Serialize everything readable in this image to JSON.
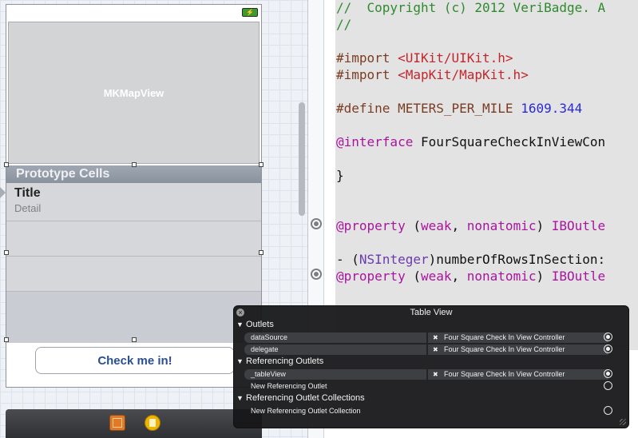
{
  "storyboard": {
    "map_view_label": "MKMapView",
    "section_header": "Prototype Cells",
    "cell_title": "Title",
    "cell_detail": "Detail",
    "checkin_button": "Check me in!"
  },
  "code": {
    "lines": [
      {
        "prefix": "//  Copyright (c) 2012 VeriBadge. A"
      },
      {
        "prefix": "//"
      },
      {
        "prefix": "#import ",
        "highlight": "<UIKit/UIKit.h>"
      },
      {
        "prefix": "#import ",
        "highlight": "<MapKit/MapKit.h>"
      },
      {
        "prefix": "#define METERS_PER_MILE ",
        "highlight": "1609.344"
      },
      {
        "prefix": "@interface",
        "rest": " FourSquareCheckInViewCon"
      },
      {
        "prefix": "}"
      },
      {
        "prefix": "@property",
        "mid": " (",
        "kw1": "weak",
        "comma": ", ",
        "kw2": "nonatomic",
        "close": ") ",
        "tail": "IBOutle"
      },
      {
        "prefix": "- (",
        "type": "NSInteger",
        "rest": ")numberOfRowsInSection:"
      },
      {
        "prefix": "@property",
        "mid": " (",
        "kw1": "weak",
        "comma": ", ",
        "kw2": "nonatomic",
        "close": ") ",
        "tail": "IBOutle"
      }
    ]
  },
  "connections_panel": {
    "title": "Table View",
    "sections": {
      "outlets": "Outlets",
      "referencing_outlets": "Referencing Outlets",
      "referencing_collections": "Referencing Outlet Collections"
    },
    "outlets": [
      {
        "name": "dataSource",
        "target": "Four Square Check In View Controller"
      },
      {
        "name": "delegate",
        "target": "Four Square Check In View Controller"
      }
    ],
    "referencing": [
      {
        "name": "_tableView",
        "target": "Four Square Check In View Controller"
      }
    ],
    "new_referencing_outlet": "New Referencing Outlet",
    "new_referencing_collection": "New Referencing Outlet Collection"
  },
  "colors": {
    "comment": "#2f8a2f",
    "string": "#c1272d",
    "number": "#2a2ad8",
    "keyword": "#a8159e"
  }
}
